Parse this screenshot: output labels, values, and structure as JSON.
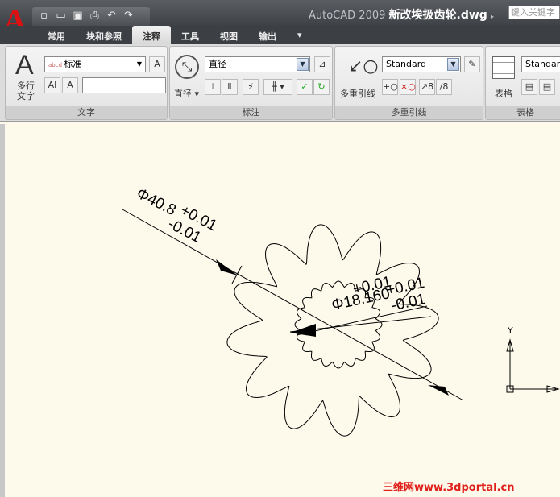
{
  "app": {
    "title_prefix": "AutoCAD 2009",
    "file_name": "新改埃扱齿轮.dwg",
    "search_placeholder": "键入关键字"
  },
  "quick_access": [
    "new-icon",
    "open-icon",
    "save-icon",
    "print-icon",
    "undo-icon",
    "redo-icon"
  ],
  "tabs": [
    {
      "label": "常用"
    },
    {
      "label": "块和参照"
    },
    {
      "label": "注释",
      "active": true
    },
    {
      "label": "工具"
    },
    {
      "label": "视图"
    },
    {
      "label": "输出"
    }
  ],
  "ribbon": {
    "text_panel": {
      "title": "文字",
      "mtext_label": "多行文字",
      "style_value": "标准",
      "height_value": ""
    },
    "dim_panel": {
      "title": "标注",
      "dim_type": "直径",
      "dim_style": "直径"
    },
    "mleader_panel": {
      "title": "多重引线",
      "button_label": "多重引线",
      "style_value": "Standard"
    },
    "table_panel": {
      "title": "表格",
      "button_label": "表格",
      "style_value": "Standard"
    }
  },
  "drawing": {
    "dim1_main": "Φ40.8",
    "dim1_upper": "+0.01",
    "dim1_lower": "-0.01",
    "dim2_main": "Φ18.160",
    "dim2_upper": "+0.01",
    "dim2_lower": "-0.01",
    "ucs_y": "Y"
  },
  "watermark": "三维网www.3dportal.cn"
}
